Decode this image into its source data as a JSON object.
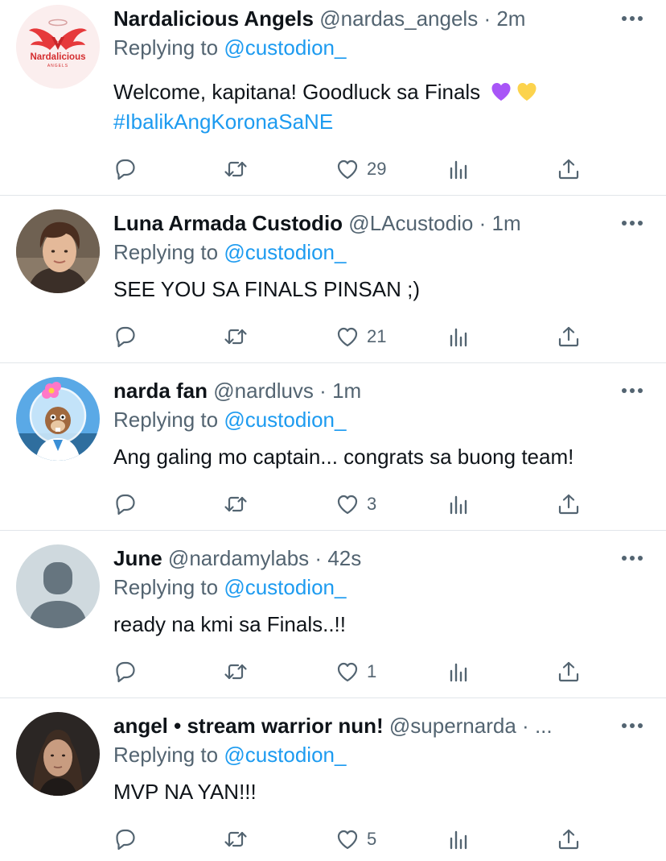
{
  "replying_label": "Replying to",
  "colors": {
    "accent": "#1d9bf0",
    "secondary": "#536471",
    "divider": "#e1e6ea"
  },
  "tweets": [
    {
      "name": "Nardalicious Angels",
      "handle": "@nardas_angels",
      "time": "2m",
      "reply_to": "@custodion_",
      "text": "Welcome, kapitana! Goodluck sa Finals",
      "hashtag": "#IbalikAngKoronaSaNE",
      "emojis": [
        "purple-heart",
        "yellow-heart"
      ],
      "avatar": "nardalicious-logo",
      "avatar_logo_text": "Nardalicious",
      "avatar_logo_subtext": "ANGELS",
      "likes": "29"
    },
    {
      "name": "Luna Armada Custodio",
      "handle": "@LAcustodio",
      "time": "1m",
      "reply_to": "@custodion_",
      "text": "SEE YOU SA FINALS PINSAN ;)",
      "avatar": "profile-photo",
      "likes": "21"
    },
    {
      "name": "narda fan",
      "handle": "@nardluvs",
      "time": "1m",
      "reply_to": "@custodion_",
      "text": "Ang galing mo captain... congrats sa buong team!",
      "avatar": "cartoon-squirrel",
      "likes": "3"
    },
    {
      "name": "June",
      "handle": "@nardamylabs",
      "time": "42s",
      "reply_to": "@custodion_",
      "text": "ready na kmi sa Finals..!!",
      "avatar": "default-avatar",
      "likes": "1"
    },
    {
      "name": "angel • stream warrior nun!",
      "handle": "@supernarda",
      "time": "...",
      "reply_to": "@custodion_",
      "text": "MVP NA YAN!!!",
      "avatar": "profile-photo",
      "likes": "5"
    }
  ]
}
